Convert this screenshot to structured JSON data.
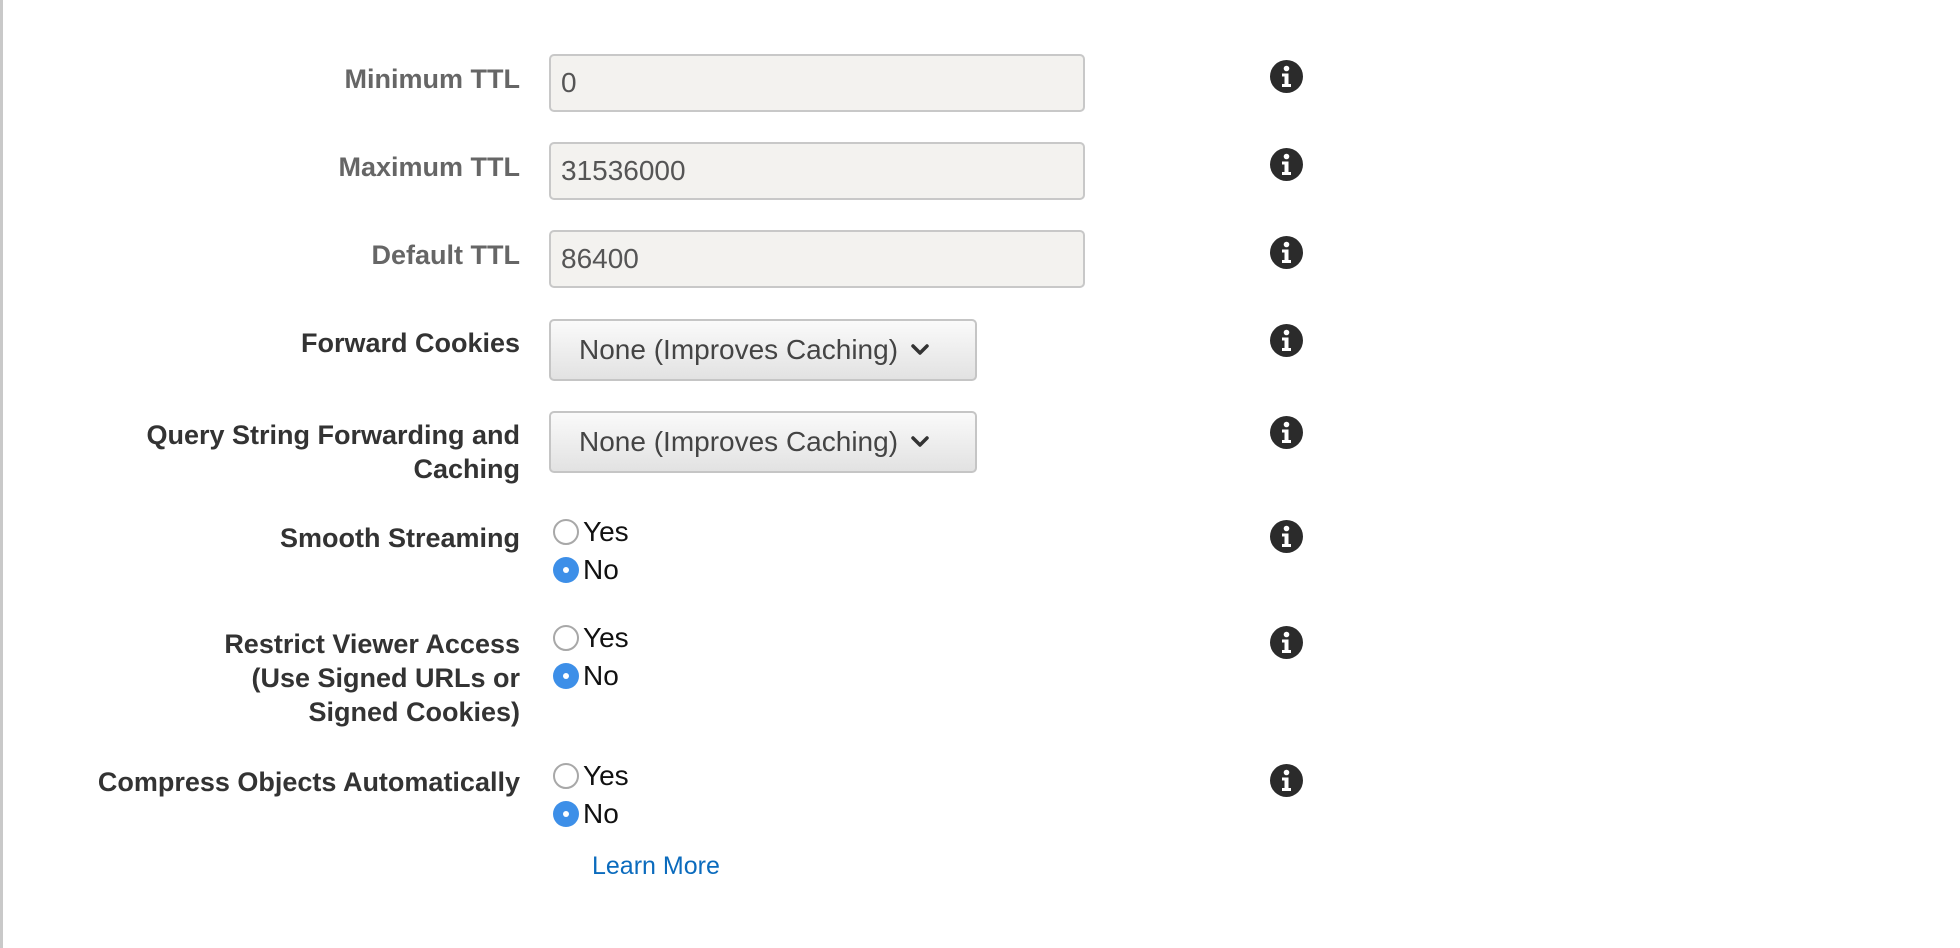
{
  "fields": {
    "minimum_ttl": {
      "label": "Minimum TTL",
      "value": "0"
    },
    "maximum_ttl": {
      "label": "Maximum TTL",
      "value": "31536000"
    },
    "default_ttl": {
      "label": "Default TTL",
      "value": "86400"
    },
    "forward_cookies": {
      "label": "Forward Cookies",
      "selected": "None (Improves Caching)"
    },
    "query_string": {
      "label_line1": "Query String Forwarding and",
      "label_line2": "Caching",
      "selected": "None (Improves Caching)"
    },
    "smooth_streaming": {
      "label": "Smooth Streaming",
      "yes": "Yes",
      "no": "No",
      "selected": "No"
    },
    "restrict_viewer_access": {
      "label_line1": "Restrict Viewer Access",
      "label_line2": "(Use Signed URLs or",
      "label_line3": "Signed Cookies)",
      "yes": "Yes",
      "no": "No",
      "selected": "No"
    },
    "compress_objects": {
      "label": "Compress Objects Automatically",
      "yes": "Yes",
      "no": "No",
      "selected": "No"
    }
  },
  "learn_more": "Learn More",
  "icons": {
    "info": "info-icon",
    "dropdown": "chevron-down-icon"
  },
  "colors": {
    "radio_selected": "#3d8fe8",
    "link": "#0b6bbd",
    "input_bg": "#f3f2ef"
  }
}
